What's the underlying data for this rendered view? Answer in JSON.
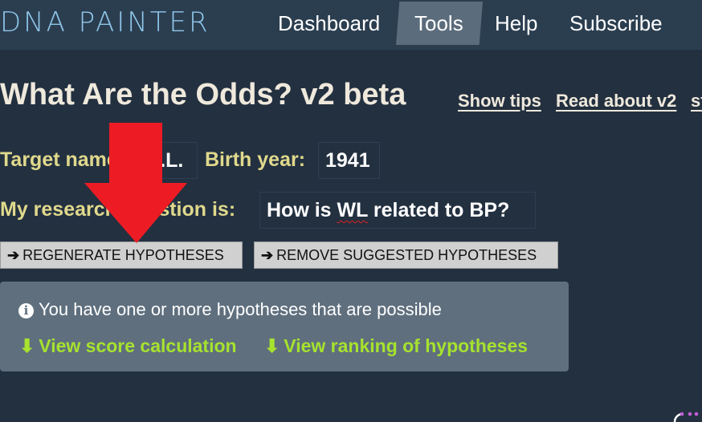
{
  "navbar": {
    "brand": "DNA PAINTER",
    "items": [
      {
        "label": "Dashboard",
        "active": false
      },
      {
        "label": "Tools",
        "active": true
      },
      {
        "label": "Help",
        "active": false
      },
      {
        "label": "Subscribe",
        "active": false
      }
    ]
  },
  "page": {
    "title": "What Are the Odds? v2 beta",
    "links": [
      "Show tips",
      "Read about v2",
      "st"
    ]
  },
  "form": {
    "target_name_label": "Target name:",
    "target_name_value": "W.L.",
    "birth_year_label": "Birth year:",
    "birth_year_value": "1941",
    "question_label": "My research question is:",
    "question_value_prefix": "How is ",
    "question_value_misspelled": "WL",
    "question_value_suffix": " related to BP?"
  },
  "buttons": {
    "regenerate": "REGENERATE HYPOTHESES",
    "remove_suggested": "REMOVE SUGGESTED HYPOTHESES",
    "arrow_glyph": "➔"
  },
  "panel": {
    "message": "You have one or more hypotheses that are possible",
    "info_glyph": "i",
    "down_glyph": "🡇",
    "links": [
      "View score calculation",
      "View ranking of hypotheses"
    ]
  },
  "colors": {
    "annotation_arrow": "#ed1c24",
    "link_green": "#a6e22e",
    "label_yellow": "#e0d98c"
  }
}
